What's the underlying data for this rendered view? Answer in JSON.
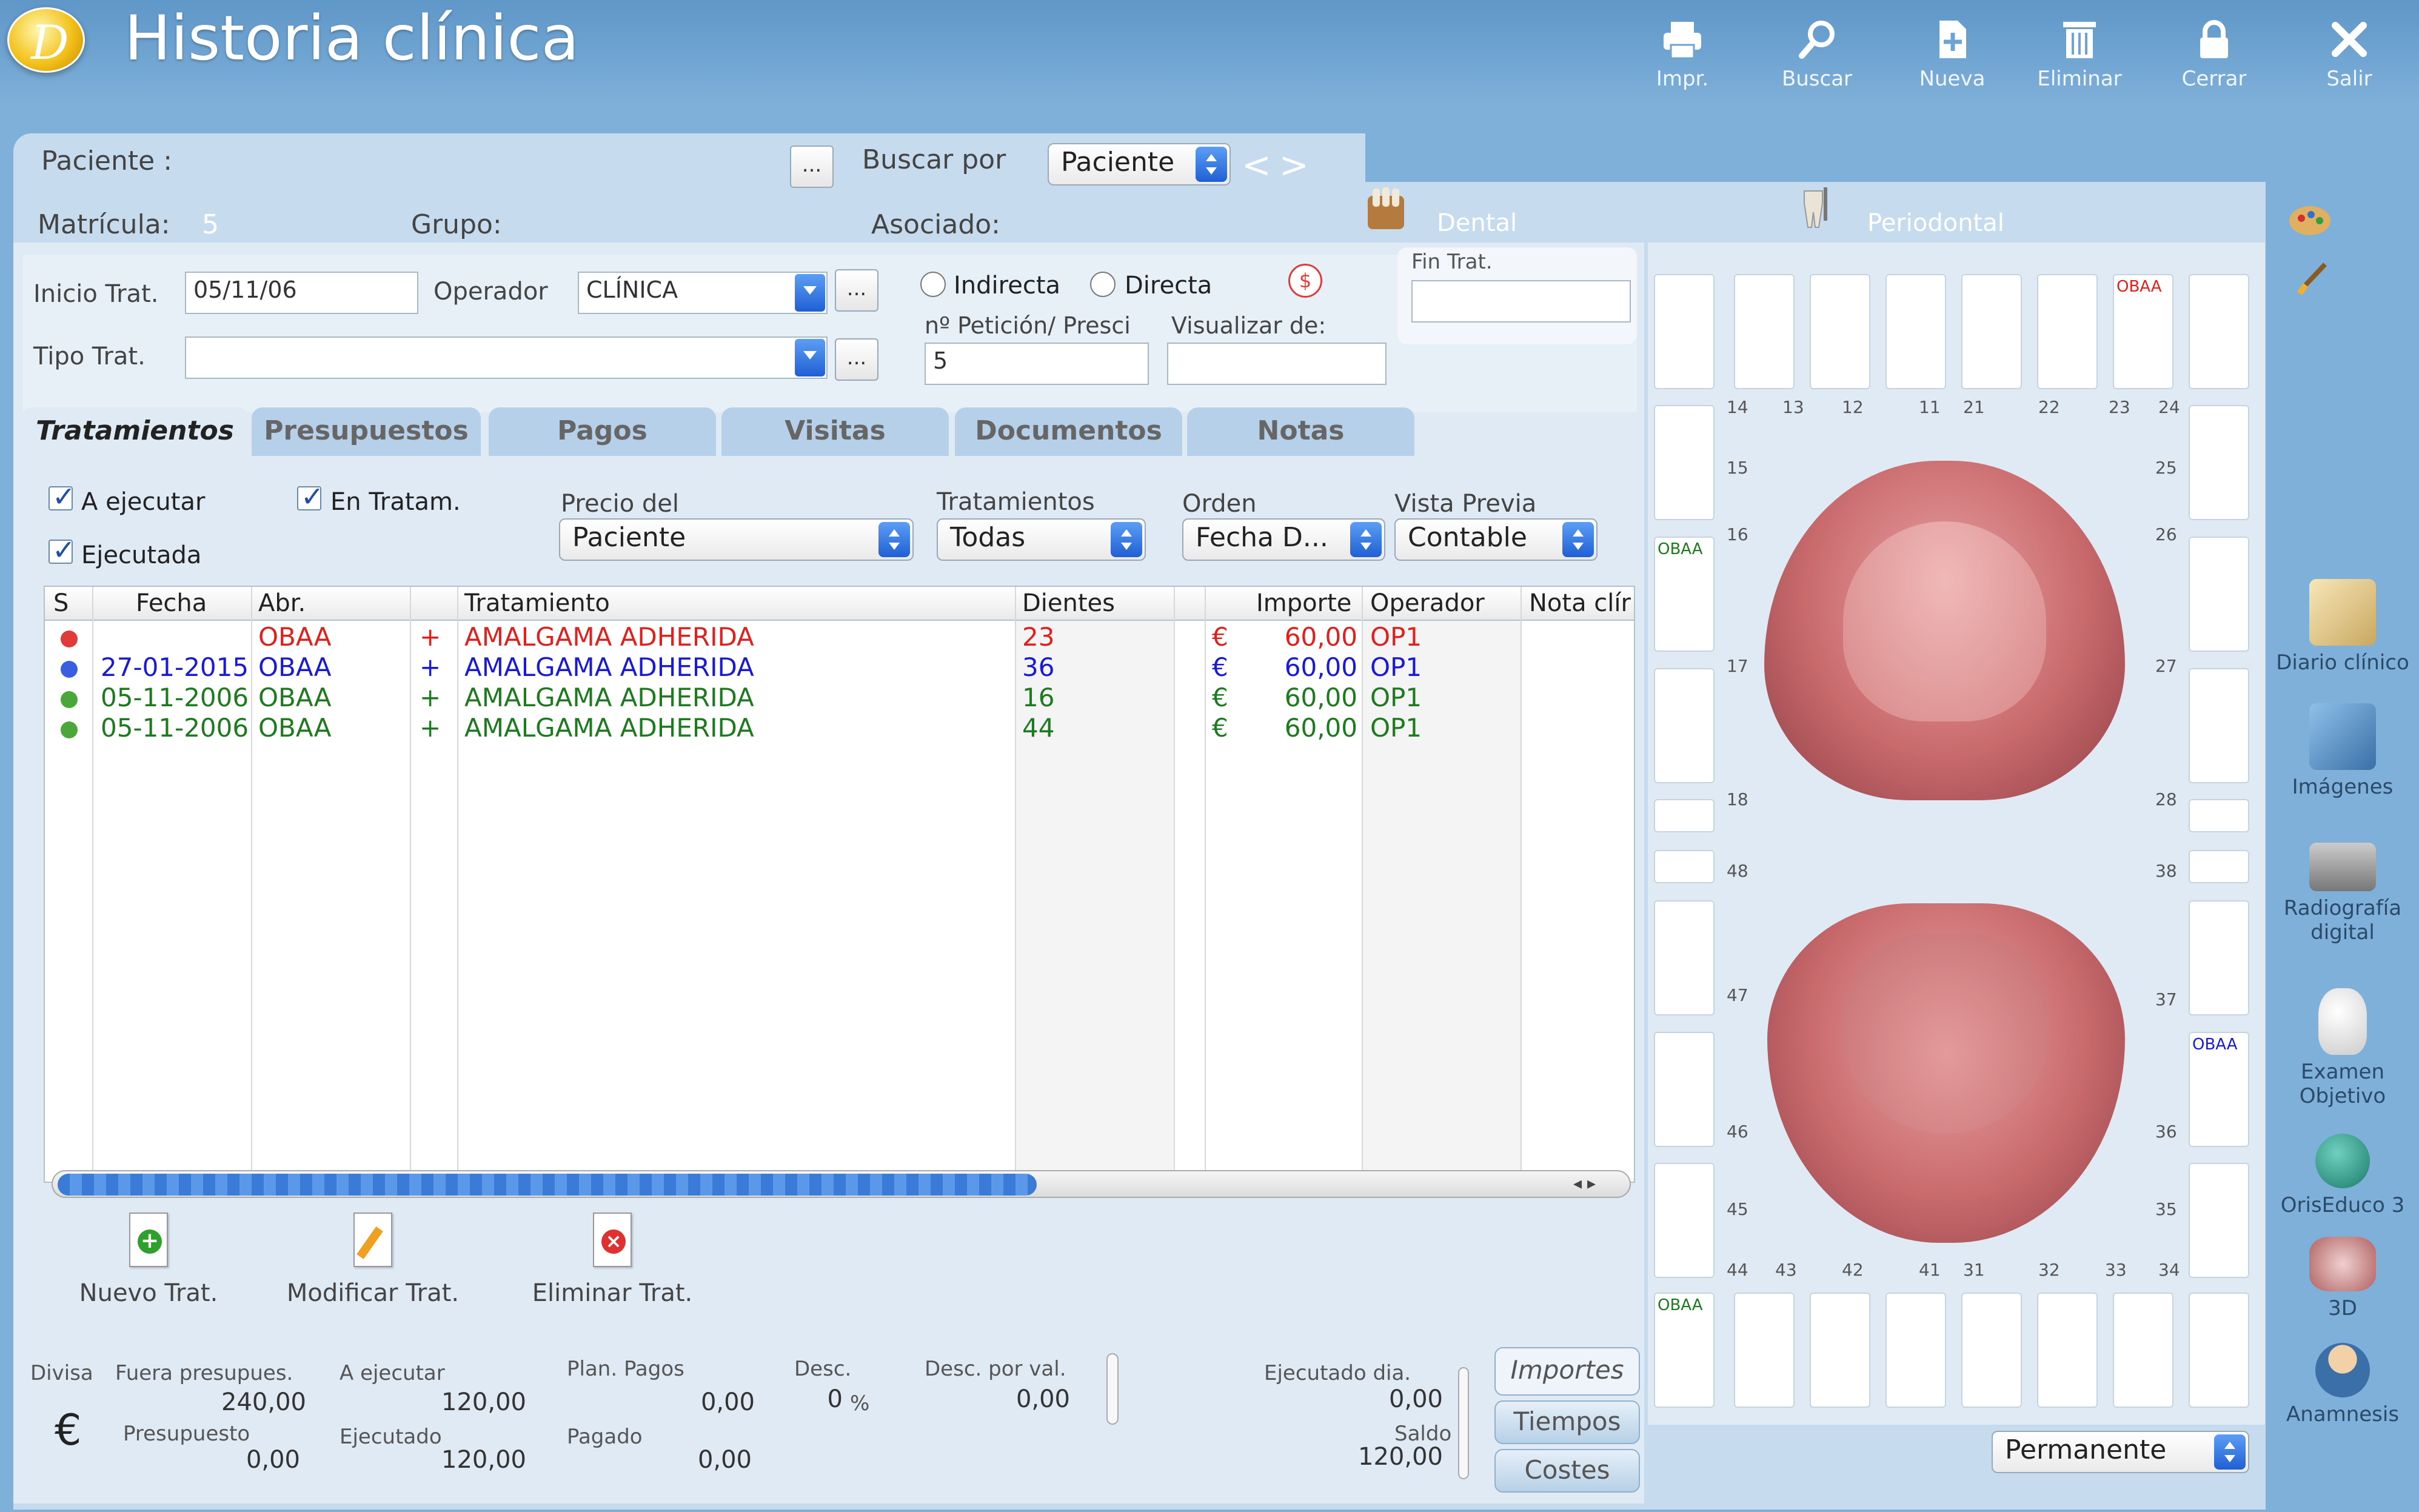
{
  "app": {
    "title": "Historia clínica"
  },
  "toolbar": [
    {
      "label": "Impr.",
      "icon": "printer-icon"
    },
    {
      "label": "Buscar",
      "icon": "search-icon"
    },
    {
      "label": "Nueva",
      "icon": "new-document-icon"
    },
    {
      "label": "Eliminar",
      "icon": "trash-icon"
    },
    {
      "label": "Cerrar",
      "icon": "lock-icon"
    },
    {
      "label": "Salir",
      "icon": "close-icon"
    }
  ],
  "header": {
    "paciente_label": "Paciente :",
    "buscar_por_label": "Buscar por",
    "buscar_por_value": "Paciente",
    "prev": "<",
    "next": ">",
    "matricula_label": "Matrícula:",
    "matricula_value": "5",
    "grupo_label": "Grupo:",
    "asociado_label": "Asociado:",
    "dental_label": "Dental",
    "periodontal_label": "Periodontal",
    "dots": "..."
  },
  "form": {
    "inicio_label": "Inicio Trat.",
    "inicio_value": "05/11/06",
    "operador_label": "Operador",
    "operador_value": "CLÍNICA",
    "tipo_label": "Tipo Trat.",
    "tipo_value": "",
    "indirecta": "Indirecta",
    "directa": "Directa",
    "money_icon": "$",
    "peticion_label": "nº Petición/ Presci",
    "peticion_value": "5",
    "visualizar_label": "Visualizar de:",
    "fin_label": "Fin Trat.",
    "fin_value": ""
  },
  "tabs": [
    "Tratamientos",
    "Presupuestos",
    "Pagos",
    "Visitas",
    "Documentos",
    "Notas"
  ],
  "filters": {
    "a_ejecutar": "A ejecutar",
    "en_tratam": "En Tratam.",
    "ejecutada": "Ejecutada",
    "precio_label": "Precio del",
    "precio_value": "Paciente",
    "trat_label": "Tratamientos",
    "trat_value": "Todas",
    "orden_label": "Orden",
    "orden_value": "Fecha D...",
    "vista_label": "Vista Previa",
    "vista_value": "Contable"
  },
  "grid": {
    "columns": [
      "S",
      "Fecha",
      "Abr.",
      "",
      "Tratamiento",
      "Dientes",
      "",
      "Importe",
      "Operador",
      "Nota clír"
    ],
    "rows": [
      {
        "color": "#e0201c",
        "dot": "#e03a3a",
        "fecha": "",
        "abr": "OBAA",
        "plus": "+",
        "trat": "AMALGAMA ADHERIDA",
        "dientes": "23",
        "cur": "€",
        "importe": "60,00",
        "op": "OP1"
      },
      {
        "color": "#1a1ad6",
        "dot": "#3a5ee0",
        "fecha": "27-01-2015",
        "abr": "OBAA",
        "plus": "+",
        "trat": "AMALGAMA ADHERIDA",
        "dientes": "36",
        "cur": "€",
        "importe": "60,00",
        "op": "OP1"
      },
      {
        "color": "#1e7a1e",
        "dot": "#4aa83a",
        "fecha": "05-11-2006",
        "abr": "OBAA",
        "plus": "+",
        "trat": "AMALGAMA ADHERIDA",
        "dientes": "16",
        "cur": "€",
        "importe": "60,00",
        "op": "OP1"
      },
      {
        "color": "#1e7a1e",
        "dot": "#4aa83a",
        "fecha": "05-11-2006",
        "abr": "OBAA",
        "plus": "+",
        "trat": "AMALGAMA ADHERIDA",
        "dientes": "44",
        "cur": "€",
        "importe": "60,00",
        "op": "OP1"
      }
    ]
  },
  "actions": {
    "nuevo": "Nuevo Trat.",
    "modificar": "Modificar Trat.",
    "eliminar": "Eliminar Trat."
  },
  "footer": {
    "divisa": "Divisa",
    "currency": "€",
    "fuera_label": "Fuera presupues.",
    "fuera_value": "240,00",
    "presupuesto_label": "Presupuesto",
    "presupuesto_value": "0,00",
    "a_ejecutar_label": "A ejecutar",
    "a_ejecutar_value": "120,00",
    "ejecutado_label": "Ejecutado",
    "ejecutado_value": "120,00",
    "plan_label": "Plan. Pagos",
    "plan_value": "0,00",
    "pagado_label": "Pagado",
    "pagado_value": "0,00",
    "desc_label": "Desc.",
    "desc_value": "0",
    "desc_unit": "%",
    "descval_label": "Desc. por val.",
    "descval_value": "0,00",
    "ejec_dia_label": "Ejecutado dia.",
    "ejec_dia_value": "0,00",
    "saldo_label": "Saldo",
    "saldo_value": "120,00",
    "importes": "Importes",
    "tiempos": "Tiempos",
    "costes": "Costes"
  },
  "teeth": {
    "upper": [
      "14",
      "13",
      "12",
      "11",
      "21",
      "22",
      "23",
      "24"
    ],
    "upper_left": [
      "15",
      "16",
      "17",
      "18"
    ],
    "upper_right": [
      "25",
      "26",
      "27",
      "28"
    ],
    "lower_left": [
      "48",
      "47",
      "46",
      "45"
    ],
    "lower_right": [
      "38",
      "37",
      "36",
      "35"
    ],
    "lower": [
      "44",
      "43",
      "42",
      "41",
      "31",
      "32",
      "33",
      "34"
    ],
    "mark_23": "OBAA",
    "mark_16": "OBAA",
    "mark_36": "OBAA",
    "mark_44": "OBAA",
    "dentition": "Permanente"
  },
  "right": [
    {
      "label": "Diario clínico",
      "icon": "journal-icon"
    },
    {
      "label": "Imágenes",
      "icon": "images-icon"
    },
    {
      "label": "Radiografía digital",
      "icon": "xray-icon"
    },
    {
      "label": "Examen Objetivo",
      "icon": "tooth-icon"
    },
    {
      "label": "OrisEduco 3",
      "icon": "orisEduco-icon"
    },
    {
      "label": "3D",
      "icon": "3d-teeth-icon"
    },
    {
      "label": "Anamnesis",
      "icon": "doctor-icon"
    }
  ]
}
